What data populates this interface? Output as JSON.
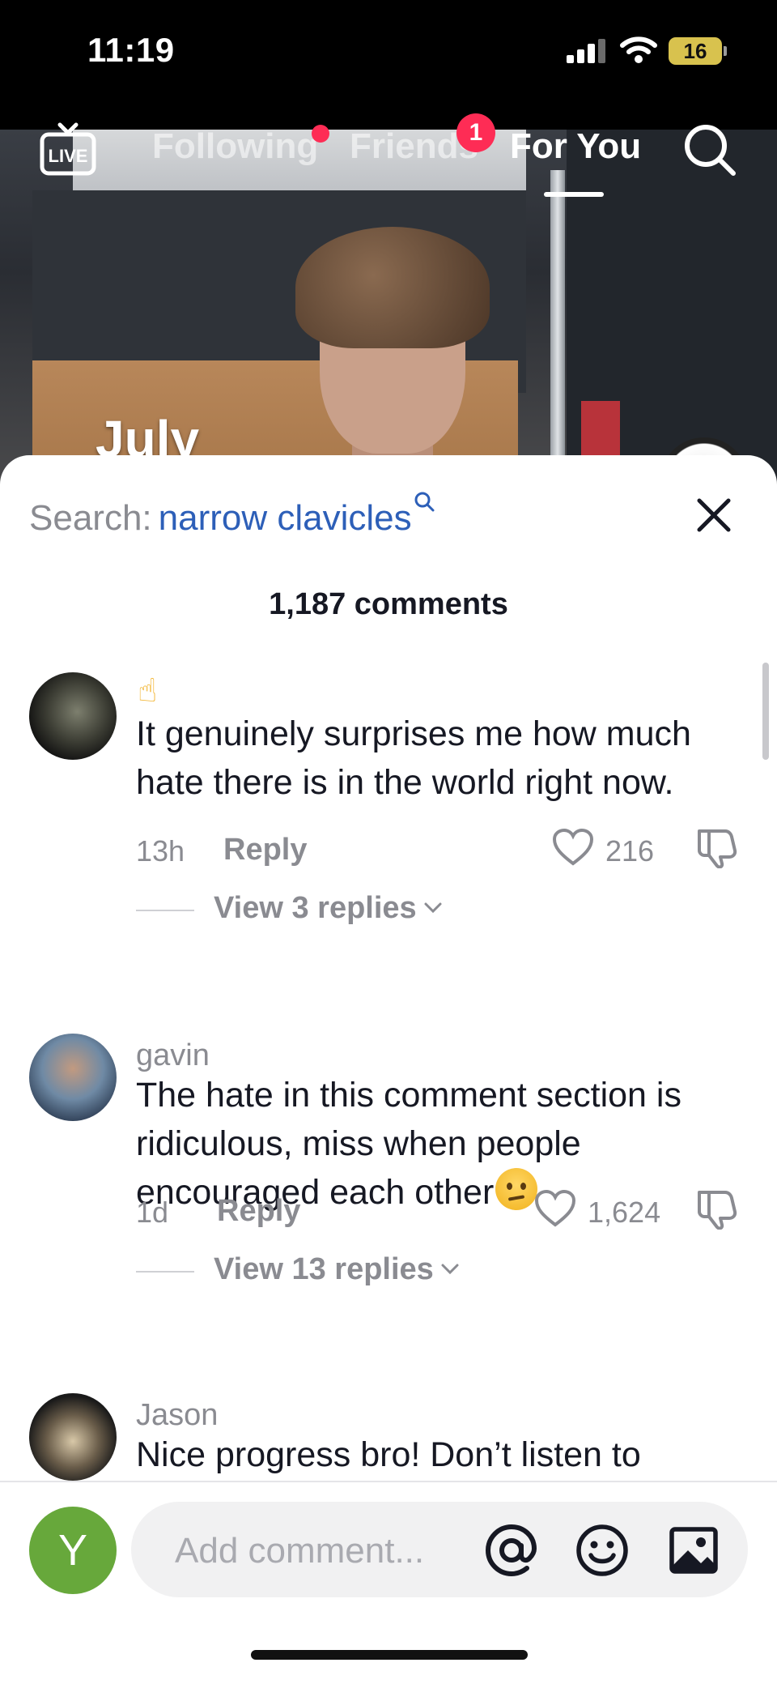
{
  "status_bar": {
    "time": "11:19",
    "battery": "16"
  },
  "top_nav": {
    "live_label": "LIVE",
    "tabs": [
      {
        "label": "Following"
      },
      {
        "label": "Friends",
        "badge": "1"
      },
      {
        "label": "For You"
      }
    ]
  },
  "video": {
    "caption": "July"
  },
  "comments_sheet": {
    "search_prefix": "Search:",
    "search_term": "narrow clavicles",
    "count_label": "1,187 comments",
    "comments": [
      {
        "username": "",
        "text": "It genuinely surprises me how much hate there is in the world right now.",
        "time": "13h",
        "reply_label": "Reply",
        "likes": "216",
        "view_replies": "View 3 replies"
      },
      {
        "username": "gavin",
        "text": "The hate in this comment section is ridiculous, miss when people encouraged each other",
        "time": "1d",
        "reply_label": "Reply",
        "likes": "1,624",
        "view_replies": "View 13 replies"
      },
      {
        "username": "Jason",
        "text": "Nice progress bro! Don’t listen to"
      }
    ]
  },
  "input_bar": {
    "avatar_letter": "Y",
    "placeholder": "Add comment..."
  },
  "colors": {
    "accent": "#fe2c55",
    "link": "#2d5fb8",
    "avatar_green": "#67a83b"
  }
}
